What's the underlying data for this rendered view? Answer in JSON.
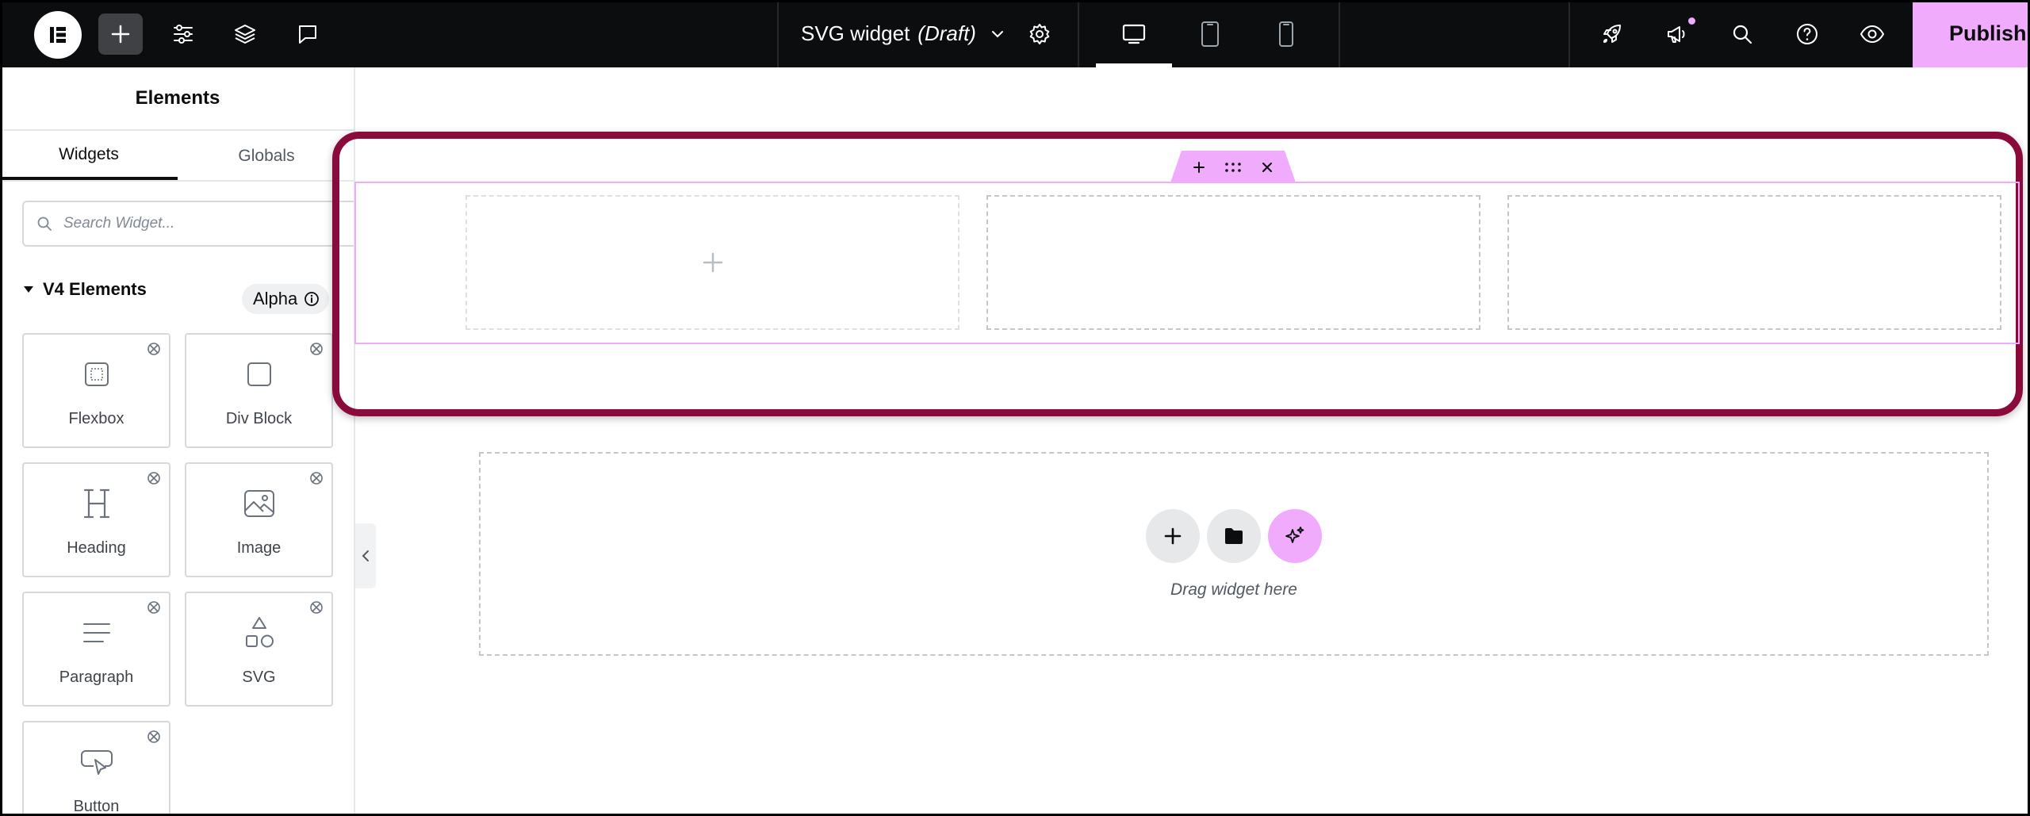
{
  "topbar": {
    "doc_title": "SVG widget",
    "doc_status": "(Draft)",
    "publish_label": "Publish"
  },
  "panel": {
    "title": "Elements",
    "tabs": [
      {
        "label": "Widgets",
        "active": true
      },
      {
        "label": "Globals",
        "active": false
      }
    ],
    "search_placeholder": "Search Widget...",
    "section_title": "V4 Elements",
    "section_badge": "Alpha",
    "widgets": [
      {
        "label": "Flexbox",
        "icon": "flexbox-icon"
      },
      {
        "label": "Div Block",
        "icon": "div-block-icon"
      },
      {
        "label": "Heading",
        "icon": "heading-icon"
      },
      {
        "label": "Image",
        "icon": "image-icon"
      },
      {
        "label": "Paragraph",
        "icon": "paragraph-icon"
      },
      {
        "label": "SVG",
        "icon": "svg-shapes-icon"
      },
      {
        "label": "Button",
        "icon": "button-icon"
      }
    ]
  },
  "canvas": {
    "dropzone_text": "Drag widget here"
  },
  "colors": {
    "topbar_bg": "#0c0d0e",
    "accent_pink": "#f0abfc",
    "highlight_border": "#8b0a3c"
  }
}
